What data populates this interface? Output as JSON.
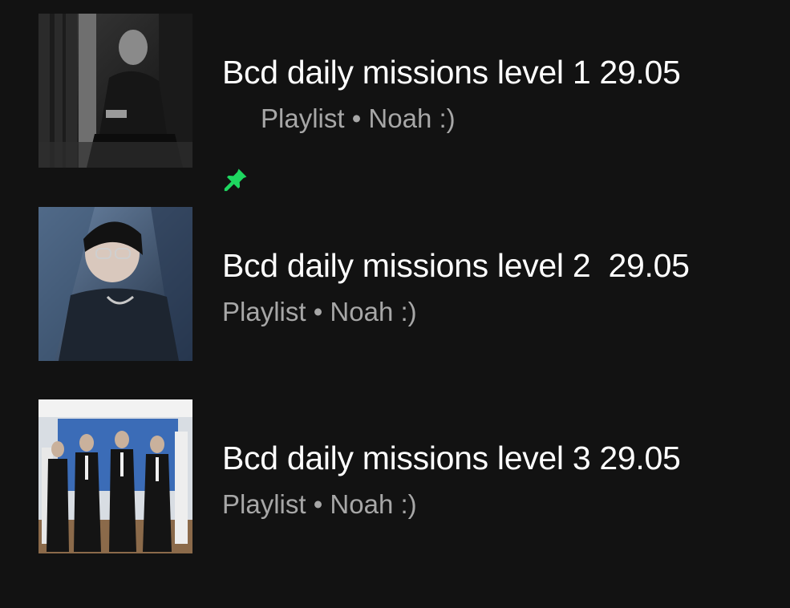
{
  "colors": {
    "background": "#121212",
    "title": "#ffffff",
    "subtitle": "#a7a7a7",
    "pin": "#1ed760"
  },
  "playlists": [
    {
      "title": "Bcd daily missions level 1 29.05",
      "subtitle": "Playlist • Noah :)",
      "pinned": true,
      "pin_icon": "pin-icon"
    },
    {
      "title": "Bcd daily missions level 2  29.05",
      "subtitle": "Playlist • Noah :)",
      "pinned": false
    },
    {
      "title": "Bcd daily missions level 3 29.05",
      "subtitle": "Playlist • Noah :)",
      "pinned": false
    }
  ]
}
